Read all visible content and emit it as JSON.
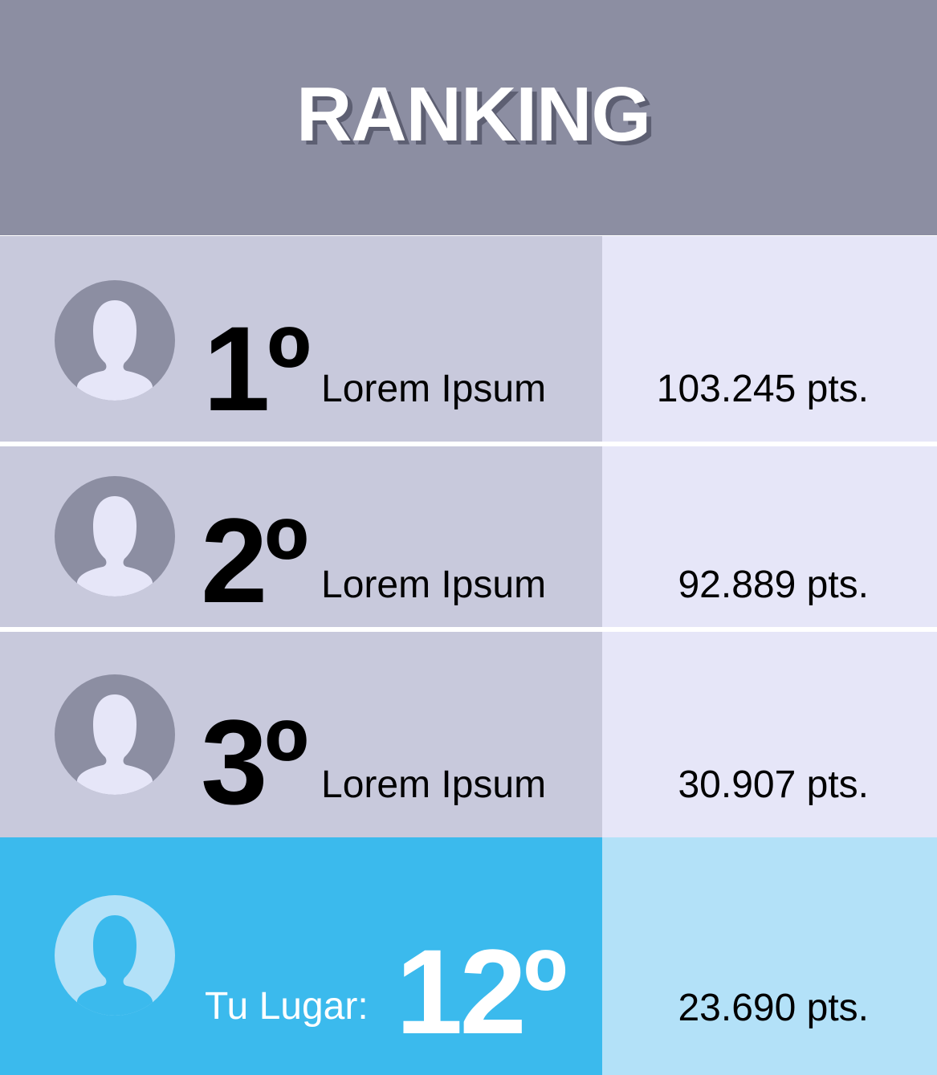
{
  "header": {
    "title": "RANKING"
  },
  "colors": {
    "header_bg": "#8c8ea2",
    "row_left_bg": "#c8c9dc",
    "row_right_bg": "#e6e6f8",
    "me_left_bg": "#3bbaed",
    "me_right_bg": "#b3e1f8"
  },
  "ranking": [
    {
      "avatar_icon": "user-silhouette-icon",
      "position": "1º",
      "name": "Lorem Ipsum",
      "points": "103.245 pts."
    },
    {
      "avatar_icon": "user-silhouette-icon",
      "position": "2º",
      "name": "Lorem Ipsum",
      "points": "92.889 pts."
    },
    {
      "avatar_icon": "user-silhouette-icon",
      "position": "3º",
      "name": "Lorem Ipsum",
      "points": "30.907 pts."
    }
  ],
  "my_place": {
    "avatar_icon": "user-silhouette-icon",
    "label": "Tu Lugar:",
    "position": "12º",
    "points": "23.690 pts."
  }
}
